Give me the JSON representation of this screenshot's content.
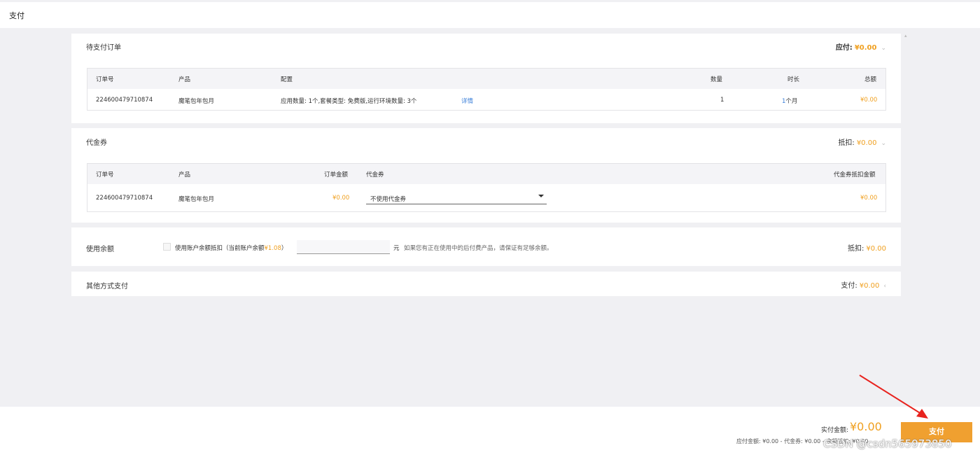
{
  "header": {
    "title": "支付"
  },
  "pending_order": {
    "title": "待支付订单",
    "amount_label": "应付:",
    "amount": "¥0.00",
    "columns": [
      "订单号",
      "产品",
      "配置",
      "数量",
      "时长",
      "总额"
    ],
    "row": {
      "order_no": "224600479710874",
      "product": "魔笔包年包月",
      "config": "应用数量: 1个,套餐类型: 免费版,运行环境数量: 3个",
      "detail_link": "详情",
      "quantity": "1",
      "duration_num": "1",
      "duration_unit": "个月",
      "total": "¥0.00"
    }
  },
  "voucher": {
    "title": "代金券",
    "amount_label": "抵扣:",
    "amount": "¥0.00",
    "columns": [
      "订单号",
      "产品",
      "订单金额",
      "代金券",
      "代金券抵扣金额"
    ],
    "row": {
      "order_no": "224600479710874",
      "product": "魔笔包年包月",
      "order_amount": "¥0.00",
      "voucher_select": "不使用代金券",
      "discount": "¥0.00"
    }
  },
  "balance": {
    "title": "使用余额",
    "checkbox_label": "使用账户余额抵扣（当前账户余额",
    "current_balance": "¥1.08",
    "close_paren": "）",
    "unit": "元",
    "note": "如果您有正在使用中的后付费产品，请保证有足够余额。",
    "amount_label": "抵扣:",
    "amount": "¥0.00"
  },
  "other": {
    "title": "其他方式支付",
    "amount_label": "支付:",
    "amount": "¥0.00"
  },
  "footer": {
    "actual_label": "实付金额:",
    "actual_amount": "¥0.00",
    "breakdown": "应付金额: ¥0.00 - 代金券: ¥0.00 - 余额抵扣: ¥0.00",
    "pay_button": "支付",
    "watermark": "CSDN @csdn565973850"
  },
  "colors": {
    "accent": "#f0a030",
    "link": "#3b7fd9",
    "annotation_arrow": "#e8231e"
  },
  "icons": [
    "chevron-down-icon",
    "chevron-up-icon",
    "chevron-left-icon",
    "caret-down-icon",
    "annotation-arrow-icon"
  ]
}
